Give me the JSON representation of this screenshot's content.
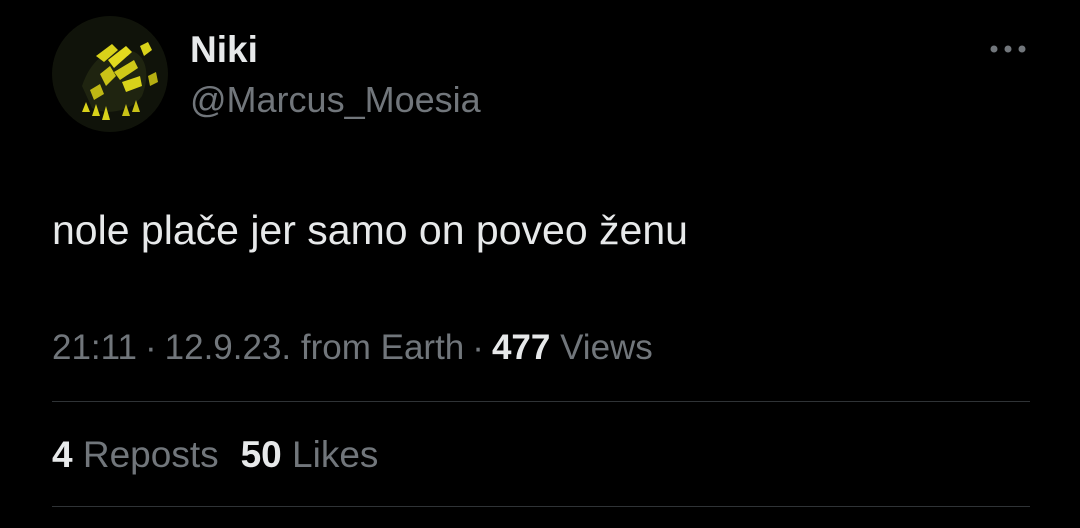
{
  "author": {
    "display_name": "Niki",
    "handle": "@Marcus_Moesia",
    "avatar_icon": "profile-avatar"
  },
  "tweet": {
    "text": "nole plače jer samo on poveo ženu"
  },
  "meta": {
    "time": "21:11",
    "separator": "·",
    "date": "12.9.23.",
    "source": "from Earth",
    "views_count": "477",
    "views_label": "Views"
  },
  "stats": {
    "reposts_count": "4",
    "reposts_label": "Reposts",
    "likes_count": "50",
    "likes_label": "Likes"
  },
  "more_icon": "more-horizontal-icon",
  "colors": {
    "background": "#000000",
    "primary_text": "#e7e9ea",
    "secondary_text": "#71767b",
    "divider": "#2f3336",
    "avatar_accent": "#d8d21a"
  }
}
